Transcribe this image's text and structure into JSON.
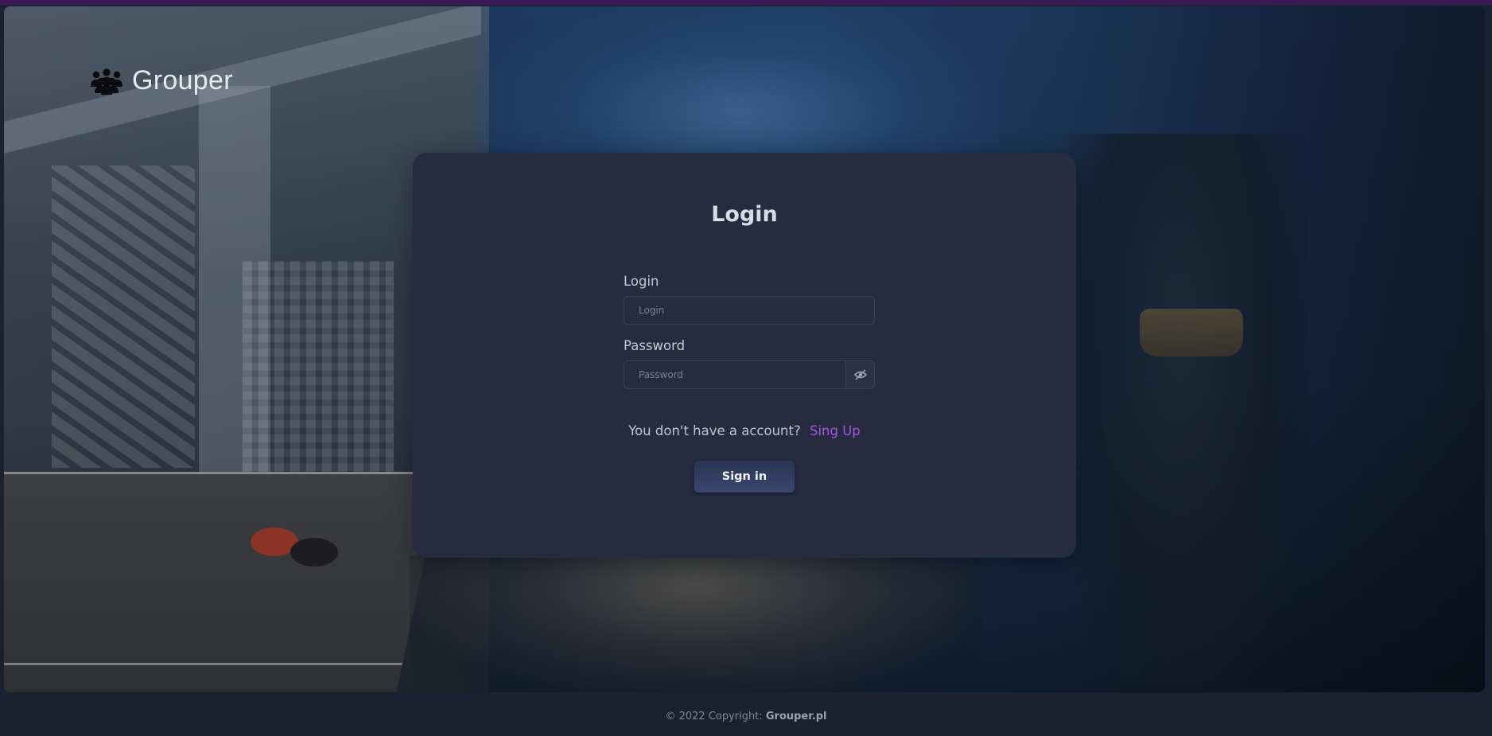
{
  "brand": {
    "name": "Grouper",
    "icon": "group-people-icon"
  },
  "login_card": {
    "title": "Login",
    "login_field": {
      "label": "Login",
      "placeholder": "Login",
      "value": ""
    },
    "password_field": {
      "label": "Password",
      "placeholder": "Password",
      "value": "",
      "toggle_icon": "eye-slash-icon"
    },
    "signup_prompt": "You don't have a account?",
    "signup_link": "Sing Up",
    "submit_label": "Sign in"
  },
  "footer": {
    "copyright_prefix": "© 2022 Copyright:",
    "copyright_site": "Grouper.pl"
  },
  "colors": {
    "card_background": "#272b40",
    "link_accent": "#a455e0",
    "button_background": "#323c62",
    "page_background": "#1a2232",
    "top_bar": "#3b1a55"
  }
}
